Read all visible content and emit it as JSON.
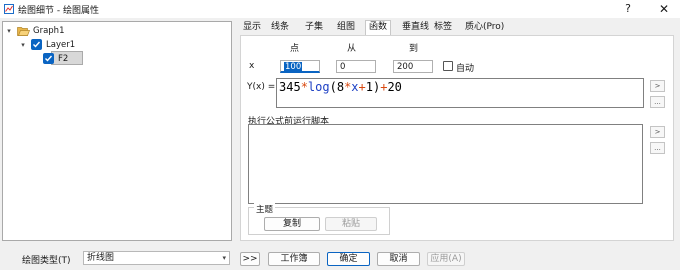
{
  "window": {
    "title": "绘图细节 - 绘图属性",
    "help_label": "?",
    "close_label": "✕"
  },
  "tree": {
    "items": [
      {
        "label": "Graph1",
        "icon": "folder-open-icon",
        "expanded": true
      },
      {
        "label": "Layer1",
        "icon": "checkbox-checked-icon",
        "expanded": true
      },
      {
        "label": "F2",
        "icon": "checkbox-checked-icon",
        "selected": true
      }
    ]
  },
  "tabs": [
    {
      "label": "显示"
    },
    {
      "label": "线条"
    },
    {
      "label": "子集"
    },
    {
      "label": "组图"
    },
    {
      "label": "函数",
      "active": true
    },
    {
      "label": "垂直线"
    },
    {
      "label": "标签"
    },
    {
      "label": "质心(Pro)"
    }
  ],
  "function_tab": {
    "col_points": "点",
    "col_from": "从",
    "col_to": "到",
    "x_label": "x",
    "points_value": "100",
    "from_value": "0",
    "to_value": "200",
    "auto_label": "自动",
    "auto_checked": false,
    "y_label": "Y(x) =",
    "formula": {
      "num": "345",
      "op1": "*",
      "fn": "log",
      "open": "(8",
      "op2": "*",
      "var": "x",
      "op3": "+",
      "close": "1)",
      "op4": "+",
      "tail": "20"
    },
    "script_label": "执行公式前运行脚本",
    "more_arrow": ">",
    "more_dots": "...",
    "theme_label": "主题",
    "copy_label": "复制",
    "paste_label": "粘贴"
  },
  "bottom": {
    "plot_type_label": "绘图类型(T)",
    "plot_type_value": "折线图",
    "expand_label": ">>",
    "workbook_label": "工作簿",
    "ok_label": "确定",
    "cancel_label": "取消",
    "apply_label": "应用(A)"
  },
  "colors": {
    "accent": "#0a64c2",
    "operator": "#d9480f",
    "keyword": "#1c3fc4"
  }
}
